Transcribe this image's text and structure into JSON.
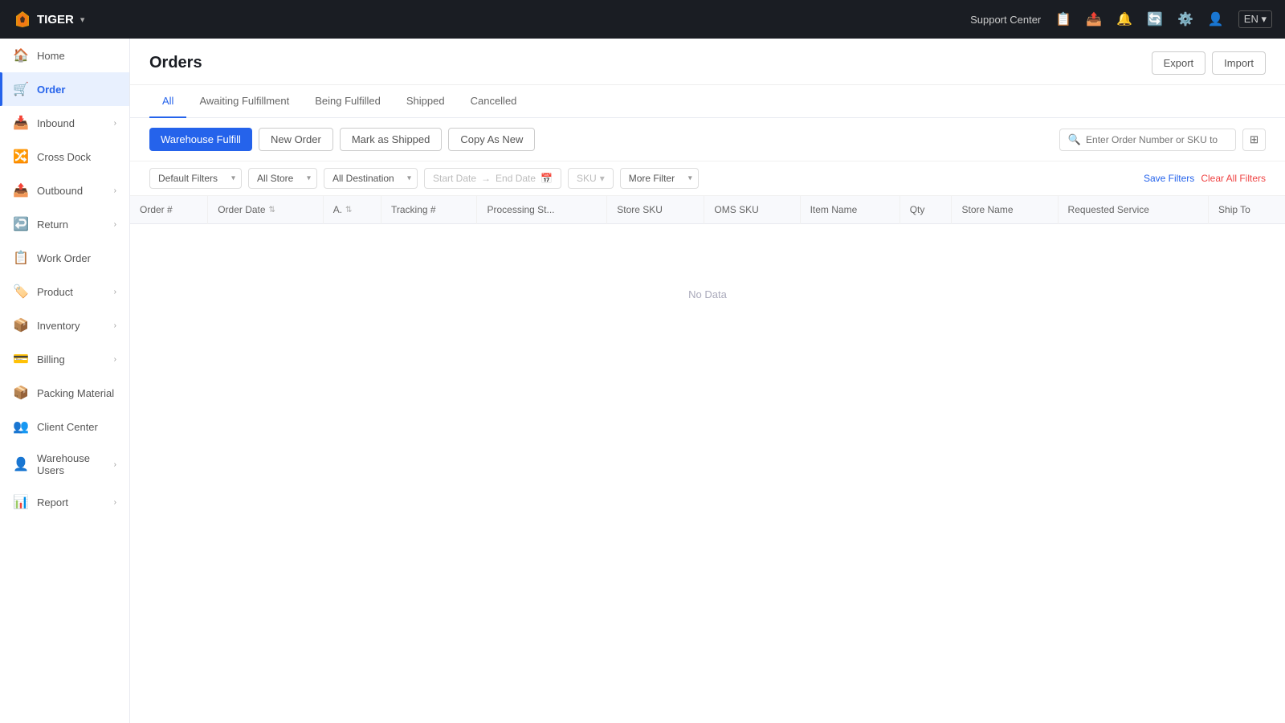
{
  "app": {
    "name": "TIGER",
    "caret": "▾",
    "lang": "EN ▾"
  },
  "topnav": {
    "support_center": "Support Center",
    "icons": [
      "📋",
      "📤",
      "🔔",
      "🔄",
      "⚙️",
      "👤"
    ]
  },
  "sidebar": {
    "items": [
      {
        "id": "home",
        "label": "Home",
        "icon": "🏠",
        "hasChevron": false,
        "active": false
      },
      {
        "id": "order",
        "label": "Order",
        "icon": "🛒",
        "hasChevron": false,
        "active": true
      },
      {
        "id": "inbound",
        "label": "Inbound",
        "icon": "📥",
        "hasChevron": true,
        "active": false
      },
      {
        "id": "cross-dock",
        "label": "Cross Dock",
        "icon": "🔀",
        "hasChevron": false,
        "active": false
      },
      {
        "id": "outbound",
        "label": "Outbound",
        "icon": "📤",
        "hasChevron": true,
        "active": false
      },
      {
        "id": "return",
        "label": "Return",
        "icon": "↩️",
        "hasChevron": true,
        "active": false
      },
      {
        "id": "work-order",
        "label": "Work Order",
        "icon": "📋",
        "hasChevron": false,
        "active": false
      },
      {
        "id": "product",
        "label": "Product",
        "icon": "🏷️",
        "hasChevron": true,
        "active": false
      },
      {
        "id": "inventory",
        "label": "Inventory",
        "icon": "📦",
        "hasChevron": true,
        "active": false
      },
      {
        "id": "billing",
        "label": "Billing",
        "icon": "💳",
        "hasChevron": true,
        "active": false
      },
      {
        "id": "packing-material",
        "label": "Packing Material",
        "icon": "📦",
        "hasChevron": false,
        "active": false
      },
      {
        "id": "client-center",
        "label": "Client Center",
        "icon": "👥",
        "hasChevron": false,
        "active": false
      },
      {
        "id": "warehouse-users",
        "label": "Warehouse Users",
        "icon": "👤",
        "hasChevron": true,
        "active": false
      },
      {
        "id": "report",
        "label": "Report",
        "icon": "📊",
        "hasChevron": true,
        "active": false
      }
    ]
  },
  "page": {
    "title": "Orders",
    "export_label": "Export",
    "import_label": "Import"
  },
  "tabs": [
    {
      "id": "all",
      "label": "All",
      "active": true
    },
    {
      "id": "awaiting",
      "label": "Awaiting Fulfillment",
      "active": false
    },
    {
      "id": "being-fulfilled",
      "label": "Being Fulfilled",
      "active": false
    },
    {
      "id": "shipped",
      "label": "Shipped",
      "active": false
    },
    {
      "id": "cancelled",
      "label": "Cancelled",
      "active": false
    }
  ],
  "actions": {
    "warehouse_fulfill": "Warehouse Fulfill",
    "new_order": "New Order",
    "mark_as_shipped": "Mark as Shipped",
    "copy_as_new": "Copy As New",
    "search_placeholder": "Enter Order Number or SKU to"
  },
  "filters": {
    "default_label": "Default Filters",
    "all_store": "All Store",
    "all_destination": "All Destination",
    "start_date": "Start Date",
    "end_date": "End Date",
    "sku": "SKU",
    "more_filter": "More Filter",
    "save_filters": "Save Filters",
    "clear_all_filters": "Clear All Filters"
  },
  "table": {
    "columns": [
      {
        "id": "order-num",
        "label": "Order #",
        "sortable": false
      },
      {
        "id": "order-date",
        "label": "Order Date",
        "sortable": true
      },
      {
        "id": "a",
        "label": "A.",
        "sortable": true
      },
      {
        "id": "tracking",
        "label": "Tracking #",
        "sortable": false
      },
      {
        "id": "processing-st",
        "label": "Processing St...",
        "sortable": false
      },
      {
        "id": "store-sku",
        "label": "Store SKU",
        "sortable": false
      },
      {
        "id": "oms-sku",
        "label": "OMS SKU",
        "sortable": false
      },
      {
        "id": "item-name",
        "label": "Item Name",
        "sortable": false
      },
      {
        "id": "qty",
        "label": "Qty",
        "sortable": false
      },
      {
        "id": "store-name",
        "label": "Store Name",
        "sortable": false
      },
      {
        "id": "requested-service",
        "label": "Requested Service",
        "sortable": false
      },
      {
        "id": "ship-to",
        "label": "Ship To",
        "sortable": false
      }
    ],
    "no_data": "No Data",
    "rows": []
  }
}
